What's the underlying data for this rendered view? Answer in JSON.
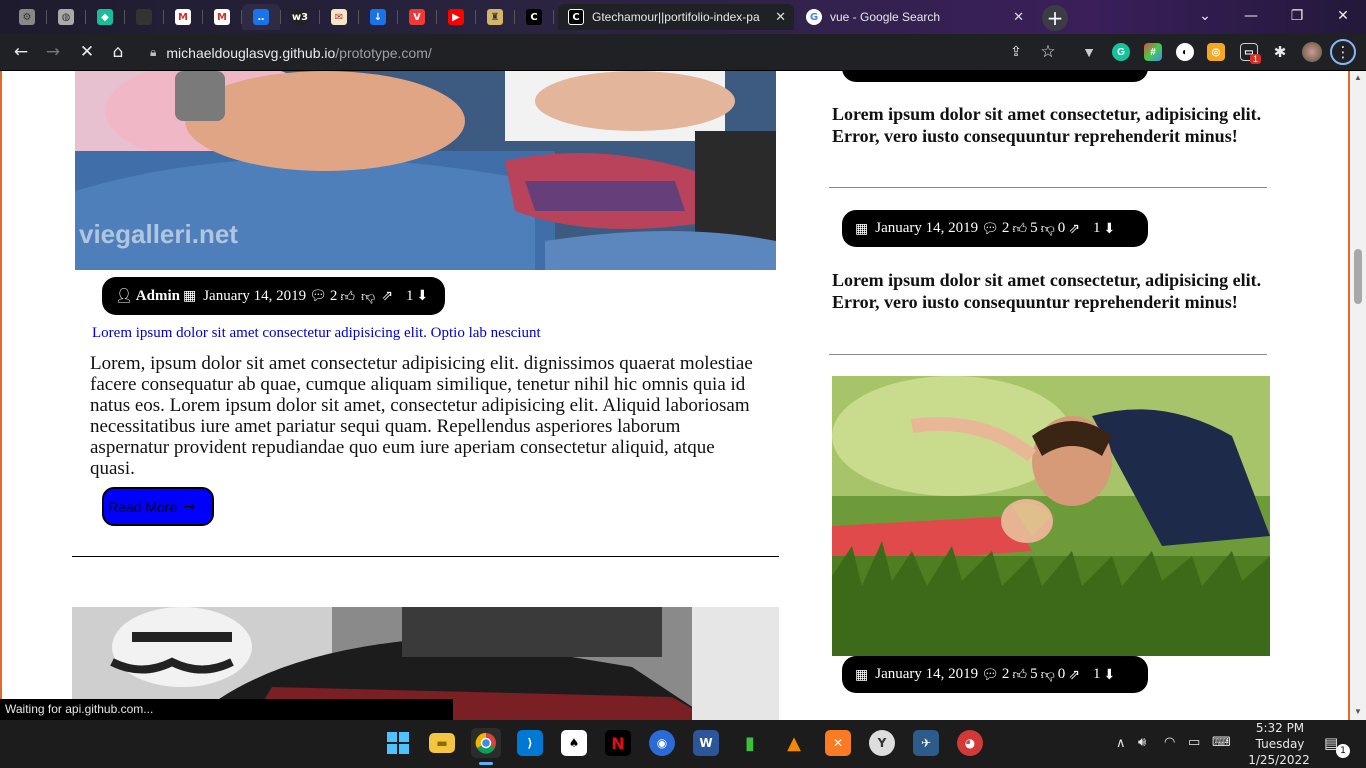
{
  "browser": {
    "tabs": [
      {
        "icon": "settings-tab-icon",
        "glyph": "⚙"
      },
      {
        "icon": "globe-tab-icon",
        "glyph": "◍"
      },
      {
        "icon": "diamond-tab-icon",
        "glyph": "◆"
      },
      {
        "icon": "blank-tab-icon",
        "glyph": ""
      },
      {
        "icon": "gmail-tab-icon",
        "glyph": "M"
      },
      {
        "icon": "gmail-tab-icon",
        "glyph": "M"
      },
      {
        "icon": "dots-tab-icon",
        "glyph": "‥"
      },
      {
        "icon": "w3schools-tab-icon",
        "glyph": "w3"
      },
      {
        "icon": "doc-tab-icon",
        "glyph": "✉"
      },
      {
        "icon": "download-tab-icon",
        "glyph": "↓"
      },
      {
        "icon": "vivaldi-tab-icon",
        "glyph": "V"
      },
      {
        "icon": "youtube-tab-icon",
        "glyph": "▶"
      },
      {
        "icon": "crest-tab-icon",
        "glyph": "♜"
      },
      {
        "icon": "c-tab-icon",
        "glyph": "C"
      }
    ],
    "active_tab_title": "Gtechamour||portifolio-index-pa",
    "second_tab_title": "vue - Google Search",
    "url_host": "michaeldouglasvg.github.io",
    "url_path": "/prototype.com/",
    "window_controls": {
      "minimize": "—",
      "maximize": "❐",
      "close": "✕",
      "dropdown": "⌄"
    },
    "new_tab": "+",
    "extension_badge": "1"
  },
  "page": {
    "main_post": {
      "watermark": "viegalleri.net",
      "meta": {
        "author": "Admin",
        "date": "January 14, 2019",
        "comments": "2",
        "likes": "",
        "dislikes": "",
        "shares": "",
        "downloads": "1"
      },
      "subtitle": "Lorem ipsum dolor sit amet consectetur adipisicing elit. Optio lab nesciunt",
      "body": "Lorem, ipsum dolor sit amet consectetur adipisicing elit. dignissimos quaerat molestiae facere consequatur ab quae, cumque aliquam similique, tenetur nihil hic omnis quia id natus eos. Lorem ipsum dolor sit amet, consectetur adipisicing elit. Aliquid laboriosam necessitatibus iure amet pariatur sequi quam. Repellendus asperiores laborum aspernatur provident repudiandae quo eum iure aperiam consectetur aliquid, atque quasi.",
      "read_more": "Read More"
    },
    "sidebar": {
      "items": [
        {
          "text": "Lorem ipsum dolor sit amet consectetur, adipisicing elit. Error, vero iusto consequuntur reprehenderit minus!"
        },
        {
          "meta": {
            "date": "January 14, 2019",
            "comments": "2",
            "likes": "5",
            "dislikes": "0",
            "shares": "",
            "downloads": "1"
          },
          "text": "Lorem ipsum dolor sit amet consectetur, adipisicing elit. Error, vero iusto consequuntur reprehenderit minus!"
        },
        {
          "meta": {
            "date": "January 14, 2019",
            "comments": "2",
            "likes": "5",
            "dislikes": "0",
            "shares": "",
            "downloads": "1"
          }
        }
      ]
    }
  },
  "status_bar": "Waiting for api.github.com...",
  "taskbar": {
    "apps": [
      "windows-start",
      "file-explorer",
      "chrome",
      "vscode",
      "solitaire",
      "netflix",
      "photo-app",
      "word",
      "green-pipe",
      "vlc",
      "xampp",
      "app-circle",
      "fort-app",
      "red-app"
    ],
    "time": "5:32 PM",
    "day": "Tuesday",
    "date": "1/25/2022",
    "notification_count": "1"
  },
  "colors": {
    "accent_border": "#e8672a",
    "read_more_bg": "#0000ff",
    "pill_bg": "#000000",
    "subtitle": "#0000cc"
  }
}
